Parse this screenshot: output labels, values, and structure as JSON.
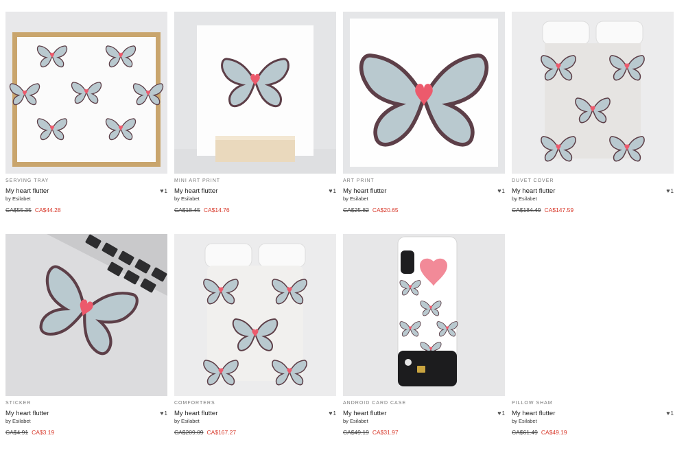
{
  "products": [
    {
      "type": "SERVING TRAY",
      "title": "My heart flutter",
      "artist": "by Esilabet",
      "old_price": "CA$55.35",
      "price": "CA$44.28",
      "likes": "1"
    },
    {
      "type": "MINI ART PRINT",
      "title": "My heart flutter",
      "artist": "by Esilabet",
      "old_price": "CA$18.45",
      "price": "CA$14.76",
      "likes": "1"
    },
    {
      "type": "ART PRINT",
      "title": "My heart flutter",
      "artist": "by Esilabet",
      "old_price": "CA$25.82",
      "price": "CA$20.65",
      "likes": "1"
    },
    {
      "type": "DUVET COVER",
      "title": "My heart flutter",
      "artist": "by Esilabet",
      "old_price": "CA$184.49",
      "price": "CA$147.59",
      "likes": "1"
    },
    {
      "type": "STICKER",
      "title": "My heart flutter",
      "artist": "by Esilabet",
      "old_price": "CA$4.91",
      "price": "CA$3.19",
      "likes": "1"
    },
    {
      "type": "COMFORTERS",
      "title": "My heart flutter",
      "artist": "by Esilabet",
      "old_price": "CA$209.09",
      "price": "CA$167.27",
      "likes": "1"
    },
    {
      "type": "ANDROID CARD CASE",
      "title": "My heart flutter",
      "artist": "by Esilabet",
      "old_price": "CA$49.19",
      "price": "CA$31.97",
      "likes": "1"
    },
    {
      "type": "PILLOW SHAM",
      "title": "My heart flutter",
      "artist": "by Esilabet",
      "old_price": "CA$61.49",
      "price": "CA$49.19",
      "likes": "1"
    }
  ],
  "like_icon": "heart-icon",
  "accent_color": "#d8392b"
}
